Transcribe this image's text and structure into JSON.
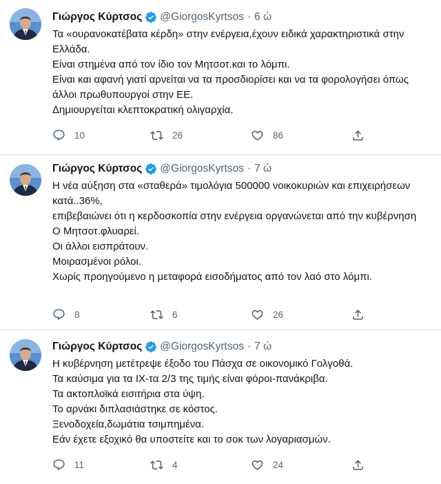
{
  "colors": {
    "text": "#0f1419",
    "muted": "#536471",
    "verified": "#1d9bf0",
    "separator": "#d6d9db"
  },
  "icons": {
    "verified": "verified-badge-icon",
    "reply": "reply-icon",
    "retweet": "retweet-icon",
    "like": "like-icon",
    "share": "share-icon"
  },
  "tweets": [
    {
      "author": "Γιώργος Κύρτσος",
      "handle": "@GiorgosKyrtsos",
      "separator": "·",
      "time": "6 ώ",
      "lines": [
        "Τα «ουρανοκατέβατα κέρδη» στην ενέργεια,έχουν ειδικά χαρακτηριστικά στην Ελλάδα.",
        "Είναι στημένα από τον ίδιο τον Μητσοτ.και το λόμπι.",
        "Είναι και αφανή γιατί αρνείται να τα προσδιορίσει και να τα φορολογήσει όπως άλλοι πρωθυπουργοί στην ΕΕ.",
        "Δημιουργείται κλεπτοκρατική ολιγαρχία."
      ],
      "replies": "10",
      "retweets": "26",
      "likes": "86"
    },
    {
      "author": "Γιώργος Κύρτσος",
      "handle": "@GiorgosKyrtsos",
      "separator": "·",
      "time": "7 ώ",
      "lines": [
        "Η νέα αύξηση στα «σταθερά» τιμολόγια 500000 νοικοκυριών και επιχειρήσεων κατά..36%,",
        "επιβεβαιώνει ότι η κερδοσκοπία στην ενέργεια οργανώνεται από την κυβέρνηση",
        "Ο Μητσοτ.φλυαρεί.",
        "Οι άλλοι εισπράτουν.",
        "Μοιρασμένοι ρόλοι.",
        "Χωρίς προηγούμενο η μεταφορά εισοδήματος από τον λαό στο λόμπι."
      ],
      "replies": "8",
      "retweets": "6",
      "likes": "26"
    },
    {
      "author": "Γιώργος Κύρτσος",
      "handle": "@GiorgosKyrtsos",
      "separator": "·",
      "time": "7 ώ",
      "lines": [
        "Η κυβέρνηση μετέτρεψε έξοδο του Πάσχα σε οικονομικό Γολγοθά.",
        "Τα καύσιμα για τα ΙΧ-τα 2/3 της τιμής είναι φόροι-πανάκριβα.",
        "Τα ακτοπλοϊκά εισιτήρια στα ύψη.",
        "Το αρνάκι διπλασιάστηκε σε κόστος.",
        "Ξενοδοχεία,δωμάτια τσιμπημένα.",
        "Εάν έχετε εξοχικό θα υποστείτε και το σοκ των λογαριασμών."
      ],
      "replies": "11",
      "retweets": "4",
      "likes": "24"
    }
  ]
}
